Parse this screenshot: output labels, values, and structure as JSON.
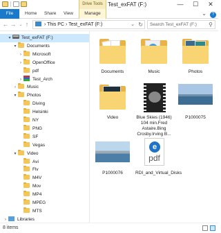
{
  "window": {
    "title": "Test_exFAT (F:)",
    "contextual_tab": "Drive Tools",
    "buttons": [
      "—",
      "☐",
      "✕"
    ]
  },
  "ribbon": {
    "tabs": [
      "File",
      "Home",
      "Share",
      "View",
      "Manage"
    ],
    "expand_icon": "chevron-down-icon",
    "help_icon": "help-icon"
  },
  "address": {
    "path_parts": [
      "This PC",
      "Test_exFAT (F:)"
    ],
    "separator": "›",
    "search_placeholder": "Search Test_exFAT (F:)"
  },
  "nav_tree": [
    {
      "label": "Test_exFAT (F:)",
      "icon": "drive-icon",
      "arrow": "▾",
      "selected": true
    },
    {
      "label": "Documents",
      "icon": "folder-icon",
      "arrow": "▾"
    },
    {
      "label": "Microsoft",
      "icon": "folder-icon",
      "arrow": "›"
    },
    {
      "label": "OpenOffice",
      "icon": "folder-icon",
      "arrow": "›"
    },
    {
      "label": "pdf",
      "icon": "folder-icon",
      "arrow": ""
    },
    {
      "label": "Test_Arch",
      "icon": "archive-icon",
      "arrow": "›"
    },
    {
      "label": "Music",
      "icon": "folder-icon",
      "arrow": "›"
    },
    {
      "label": "Photos",
      "icon": "folder-icon",
      "arrow": "▾"
    },
    {
      "label": "Diving",
      "icon": "folder-icon",
      "arrow": ""
    },
    {
      "label": "Helsinki",
      "icon": "folder-icon",
      "arrow": ""
    },
    {
      "label": "NY",
      "icon": "folder-icon",
      "arrow": ""
    },
    {
      "label": "PNG",
      "icon": "folder-icon",
      "arrow": ""
    },
    {
      "label": "SF",
      "icon": "folder-icon",
      "arrow": ""
    },
    {
      "label": "Vegas",
      "icon": "folder-icon",
      "arrow": ""
    },
    {
      "label": "Video",
      "icon": "folder-icon",
      "arrow": "▾"
    },
    {
      "label": "Avi",
      "icon": "folder-icon",
      "arrow": ""
    },
    {
      "label": "Flv",
      "icon": "folder-icon",
      "arrow": ""
    },
    {
      "label": "M4V",
      "icon": "folder-icon",
      "arrow": ""
    },
    {
      "label": "Mov",
      "icon": "folder-icon",
      "arrow": ""
    },
    {
      "label": "MP4",
      "icon": "folder-icon",
      "arrow": ""
    },
    {
      "label": "MPEG",
      "icon": "folder-icon",
      "arrow": ""
    },
    {
      "label": "MTS",
      "icon": "folder-icon",
      "arrow": ""
    },
    {
      "label": "Libraries",
      "icon": "library-icon",
      "arrow": "›"
    }
  ],
  "files": [
    {
      "name": "Documents",
      "kind": "folder"
    },
    {
      "name": "Music",
      "kind": "folder"
    },
    {
      "name": "Photos",
      "kind": "folder"
    },
    {
      "name": "Video",
      "kind": "folder"
    },
    {
      "name": "Blue Skies (1946) 104 min.Fred Astaire.Bing Crosby.Irving B...",
      "kind": "video"
    },
    {
      "name": "P1000075",
      "kind": "image"
    },
    {
      "name": "P1000076",
      "kind": "image"
    },
    {
      "name": "RDI_and_Virtual_Disks",
      "kind": "pdf"
    }
  ],
  "pdf_icon": {
    "glyph": "e",
    "text": "pdf"
  },
  "status": {
    "item_count": "8 items"
  },
  "colors": {
    "accent": "#1979ca",
    "selection": "#cce8ff",
    "folder": "#f4c657"
  }
}
